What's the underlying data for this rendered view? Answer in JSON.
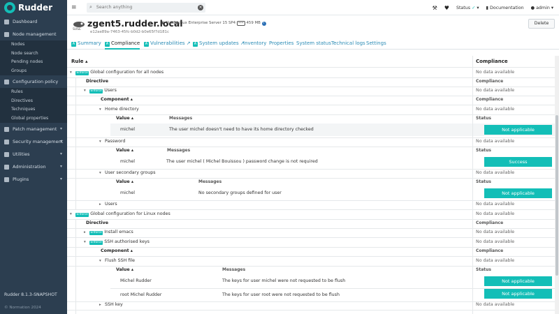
{
  "app": {
    "name": "Rudder",
    "version": "Rudder 8.1.3-SNAPSHOT",
    "copyright": "© Normation 2024"
  },
  "sidebar": {
    "items": [
      {
        "label": "Dashboard",
        "icon": "dashboard-icon"
      },
      {
        "label": "Node management",
        "icon": "sitemap-icon",
        "sub": [
          "Nodes",
          "Node search",
          "Pending nodes",
          "Groups"
        ]
      },
      {
        "label": "Configuration policy",
        "icon": "book-icon",
        "sub": [
          "Rules",
          "Directives",
          "Techniques",
          "Global properties"
        ]
      },
      {
        "label": "Patch management",
        "icon": "refresh-icon"
      },
      {
        "label": "Security management",
        "icon": "shield-icon"
      },
      {
        "label": "Utilities",
        "icon": "wrench-icon"
      },
      {
        "label": "Administration",
        "icon": "gear-icon"
      },
      {
        "label": "Plugins",
        "icon": "puzzle-icon"
      }
    ]
  },
  "topbar": {
    "search_placeholder": "Search anything",
    "status_label": "Status",
    "documentation": "Documentation",
    "user": "admin"
  },
  "node": {
    "hostname": "zgent5.rudder.local",
    "os": "SUSE Linux Enterprise Server 15 SP4",
    "memory": "459 MB",
    "uuid": "e12ae89a-7463-45fc-b0d2-b0e65f7d181c",
    "os_logo_text": "SUSE",
    "delete_label": "Delete"
  },
  "tabs": [
    {
      "label": "Summary",
      "badge": true,
      "ext": false
    },
    {
      "label": "Compliance",
      "badge": true,
      "ext": false,
      "active": true
    },
    {
      "label": "Vulnerabilities",
      "badge": true,
      "ext": true
    },
    {
      "label": "System updates",
      "badge": true,
      "ext": true
    },
    {
      "label": "Inventory"
    },
    {
      "label": "Properties"
    },
    {
      "label": "System status"
    },
    {
      "label": "Technical logs"
    },
    {
      "label": "Settings"
    }
  ],
  "table": {
    "col_rule": "Rule",
    "col_compliance": "Compliance",
    "col_directive": "Directive",
    "col_component": "Component",
    "col_value": "Value",
    "col_messages": "Messages",
    "col_status": "Status",
    "no_data": "No data available",
    "enforce": "Enforce",
    "rule1": "Global configuration for all nodes",
    "dir_users": "Users",
    "comp_home": "Home directory",
    "home_value": "michel",
    "home_msg": "The user michel doesn't need to have its home directory checked",
    "home_status": "Not applicable",
    "comp_password": "Password",
    "pw_value": "michel",
    "pw_msg": "The user michel ( Michel Bouissou ) password change is not required",
    "pw_status": "Success",
    "comp_secgroups": "User secondary groups",
    "sg_value": "michel",
    "sg_msg": "No secondary groups defined for user",
    "sg_status": "Not applicable",
    "comp_users": "Users",
    "rule2": "Global configuration for Linux nodes",
    "dir_emacs": "Install emacs",
    "dir_ssh": "SSH authorised keys",
    "comp_flush": "Flush SSH file",
    "fl1_value": "Michel Rudder",
    "fl1_msg": "The keys for user michel were not requested to be flush",
    "fl1_status": "Not applicable",
    "fl2_value": "root Michel Rudder",
    "fl2_msg": "The keys for user root were not requested to be flush",
    "fl2_status": "Not applicable",
    "comp_sshkey": "SSH key"
  },
  "colors": {
    "accent": "#13beb7",
    "sidebar_bg": "#2c3e50"
  }
}
